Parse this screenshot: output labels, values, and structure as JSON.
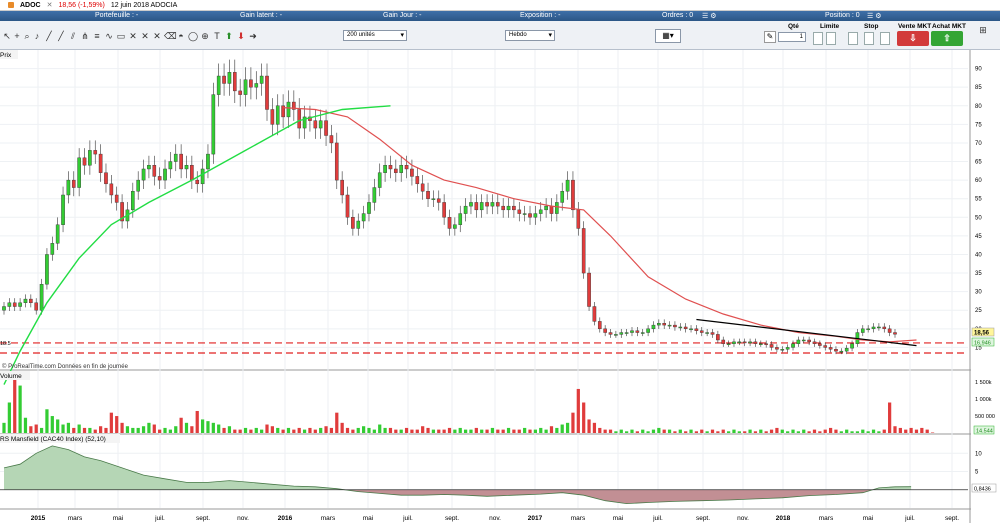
{
  "title_bar": {
    "symbol": "ADOC",
    "change": "18,56 (-1,59%)",
    "date_name": "12 juin 2018 ADOCIA"
  },
  "header": {
    "portfolio": "Portefeuille : -",
    "latent_gain": "Gain latent : -",
    "day_gain": "Gain Jour : -",
    "exposure": "Exposition : -",
    "orders": "Ordres : 0",
    "position": "Position : 0"
  },
  "toolbar": {
    "quantity_select": "200 unités",
    "period_select": "Hebdo",
    "qty_label": "Qté",
    "qty_value": "1",
    "limit_label": "Limite",
    "stop_label": "Stop",
    "sell_mkt_label": "Vente MKT",
    "buy_mkt_label": "Achat MKT"
  },
  "colors": {
    "up": "#33cc33",
    "down": "#e03c3c",
    "ma_fast": "#22dd44",
    "ma_slow": "#e05050",
    "mansfield_fill": "#b5d6b5",
    "mansfield_neg_fill": "#c28f94"
  },
  "panels": {
    "price": {
      "label": "Prix",
      "source_note": "© ProRealTime.com  Données en fin de journée",
      "last_price": "18,56",
      "ma_last": "16,946",
      "left_label": "18.5"
    },
    "volume": {
      "label": "Volume",
      "last_volume": "14.544"
    },
    "mansfield": {
      "label": "RS Mansfield (CAC40 Index) (52,10)",
      "last_value": "0,8436"
    }
  },
  "chart_data": [
    {
      "type": "candlestick",
      "ylim": [
        10,
        95
      ],
      "y_ticks": [
        15,
        20,
        25,
        30,
        35,
        40,
        45,
        50,
        55,
        60,
        65,
        70,
        75,
        80,
        85,
        90
      ],
      "x_tick_labels": [
        "2015",
        "mars",
        "mai",
        "juil.",
        "sept.",
        "nov.",
        "2016",
        "mars",
        "mai",
        "juil.",
        "sept.",
        "nov.",
        "2017",
        "mars",
        "mai",
        "juil.",
        "sept.",
        "nov.",
        "2018",
        "mars",
        "mai",
        "juil.",
        "sept."
      ],
      "closes": [
        26,
        27,
        26,
        27,
        28,
        27,
        25,
        32,
        40,
        43,
        48,
        56,
        60,
        58,
        66,
        64,
        68,
        67,
        62,
        59,
        56,
        54,
        49,
        52,
        57,
        60,
        63,
        64,
        61,
        60,
        63,
        65,
        67,
        63,
        64,
        60,
        59,
        63,
        67,
        83,
        88,
        86,
        89,
        84,
        83,
        87,
        85,
        86,
        88,
        79,
        75,
        80,
        77,
        81,
        79,
        74,
        77,
        76,
        74,
        76,
        72,
        70,
        60,
        56,
        50,
        47,
        49,
        51,
        54,
        58,
        62,
        64,
        63,
        62,
        64,
        63,
        61,
        59,
        57,
        55,
        55,
        54,
        50,
        47,
        48,
        51,
        53,
        54,
        52,
        54,
        53,
        54,
        53,
        52,
        53,
        52,
        51,
        51,
        50,
        51,
        52,
        53,
        51,
        54,
        57,
        60,
        52,
        47,
        35,
        26,
        22,
        20,
        19,
        18.5,
        18.5,
        19,
        19,
        19.5,
        19,
        19,
        20,
        21,
        21.5,
        21,
        21,
        20.5,
        20.5,
        20,
        20,
        19.5,
        19,
        19,
        18.5,
        17,
        16,
        16,
        16.5,
        16.5,
        16.2,
        16.5,
        16,
        16,
        15.8,
        15,
        14.5,
        14.5,
        15,
        16,
        17,
        17,
        16.5,
        16,
        15.5,
        15,
        14.5,
        14,
        14,
        14.8,
        16,
        19,
        20,
        20,
        20.5,
        20.5,
        20,
        19,
        18.56
      ],
      "ma_fast": [
        [
          0,
          5
        ],
        [
          3,
          14
        ],
        [
          8,
          27
        ],
        [
          14,
          39
        ],
        [
          20,
          48
        ],
        [
          27,
          54
        ],
        [
          35,
          60
        ],
        [
          45,
          68
        ],
        [
          55,
          76
        ],
        [
          63,
          79
        ],
        [
          72,
          80
        ]
      ],
      "ma_slow": [
        [
          52,
          79.5
        ],
        [
          58,
          79
        ],
        [
          64,
          77
        ],
        [
          70,
          71
        ],
        [
          76,
          64
        ],
        [
          82,
          60
        ],
        [
          88,
          58
        ],
        [
          95,
          55
        ],
        [
          102,
          53
        ],
        [
          108,
          52
        ],
        [
          113,
          45
        ],
        [
          120,
          34
        ],
        [
          127,
          28
        ],
        [
          134,
          24
        ],
        [
          141,
          21
        ],
        [
          148,
          19
        ],
        [
          155,
          18
        ],
        [
          160,
          17
        ],
        [
          165,
          16.5
        ],
        [
          170,
          17
        ]
      ],
      "trend_line": [
        [
          129,
          22.5
        ],
        [
          170,
          15.5
        ]
      ],
      "support_lines": [
        16.2,
        13.5
      ],
      "series": [
        {
          "name": "ADOC",
          "color": "#33cc33"
        }
      ]
    },
    {
      "type": "bar",
      "ylim": [
        0,
        1800000
      ],
      "y_tick_labels": [
        "1 500k",
        "1 000k",
        "500 000"
      ],
      "y_tick_values": [
        1500000,
        1000000,
        500000
      ],
      "values": [
        300000,
        900000,
        1750000,
        1400000,
        450000,
        200000,
        250000,
        150000,
        700000,
        500000,
        400000,
        250000,
        300000,
        150000,
        250000,
        150000,
        150000,
        100000,
        200000,
        150000,
        600000,
        500000,
        300000,
        200000,
        150000,
        150000,
        200000,
        300000,
        250000,
        100000,
        150000,
        100000,
        200000,
        450000,
        300000,
        200000,
        650000,
        400000,
        350000,
        300000,
        250000,
        150000,
        200000,
        100000,
        100000,
        150000,
        100000,
        150000,
        100000,
        250000,
        200000,
        150000,
        100000,
        150000,
        100000,
        150000,
        100000,
        150000,
        100000,
        150000,
        200000,
        150000,
        600000,
        300000,
        150000,
        100000,
        150000,
        200000,
        150000,
        100000,
        250000,
        150000,
        150000,
        100000,
        100000,
        150000,
        100000,
        100000,
        200000,
        150000,
        100000,
        100000,
        100000,
        150000,
        100000,
        150000,
        100000,
        100000,
        150000,
        100000,
        100000,
        150000,
        100000,
        100000,
        150000,
        100000,
        100000,
        150000,
        100000,
        100000,
        150000,
        100000,
        200000,
        150000,
        250000,
        300000,
        600000,
        1300000,
        900000,
        400000,
        300000,
        150000,
        100000,
        100000,
        50000,
        100000,
        50000,
        100000,
        50000,
        100000,
        50000,
        100000,
        150000,
        100000,
        100000,
        50000,
        100000,
        50000,
        100000,
        50000,
        100000,
        50000,
        100000,
        50000,
        100000,
        50000,
        100000,
        50000,
        50000,
        100000,
        50000,
        100000,
        50000,
        100000,
        150000,
        100000,
        50000,
        100000,
        50000,
        100000,
        50000,
        100000,
        50000,
        100000,
        150000,
        100000,
        50000,
        100000,
        50000,
        50000,
        100000,
        50000,
        100000,
        50000,
        100000,
        900000,
        200000,
        150000,
        100000,
        150000,
        100000,
        150000,
        100000,
        14544
      ]
    },
    {
      "type": "area",
      "ylim": [
        -5,
        15
      ],
      "y_ticks": [
        10,
        5,
        0
      ],
      "values": [
        [
          0,
          6
        ],
        [
          3,
          7
        ],
        [
          6,
          10
        ],
        [
          9,
          12
        ],
        [
          12,
          11
        ],
        [
          15,
          9
        ],
        [
          18,
          8
        ],
        [
          22,
          6
        ],
        [
          26,
          4
        ],
        [
          30,
          3
        ],
        [
          34,
          2
        ],
        [
          38,
          2
        ],
        [
          42,
          2.5
        ],
        [
          46,
          2
        ],
        [
          50,
          1.5
        ],
        [
          54,
          1
        ],
        [
          58,
          0.8
        ],
        [
          62,
          0.3
        ],
        [
          66,
          -0.5
        ],
        [
          70,
          -1
        ],
        [
          74,
          -1.5
        ],
        [
          78,
          -1.5
        ],
        [
          82,
          -1.3
        ],
        [
          86,
          -1.5
        ],
        [
          90,
          -1.8
        ],
        [
          95,
          -1.5
        ],
        [
          100,
          -1.2
        ],
        [
          104,
          -0.8
        ],
        [
          108,
          -1.5
        ],
        [
          112,
          -3
        ],
        [
          116,
          -3.8
        ],
        [
          120,
          -3.5
        ],
        [
          125,
          -3.2
        ],
        [
          130,
          -3
        ],
        [
          135,
          -2.8
        ],
        [
          140,
          -2.5
        ],
        [
          145,
          -2.2
        ],
        [
          150,
          -1.6
        ],
        [
          155,
          -1.3
        ],
        [
          160,
          -0.8
        ],
        [
          163,
          0.5
        ],
        [
          166,
          0.8
        ],
        [
          169,
          0.84
        ]
      ]
    }
  ]
}
